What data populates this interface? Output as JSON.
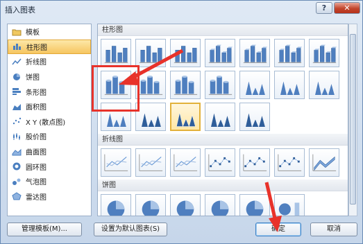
{
  "window": {
    "title": "插入图表",
    "help_label": "?",
    "close_label": "✕"
  },
  "sidebar": {
    "items": [
      {
        "label": "模板",
        "icon": "folder-icon"
      },
      {
        "label": "柱形图",
        "icon": "column-chart-icon",
        "selected": true
      },
      {
        "label": "折线图",
        "icon": "line-chart-icon"
      },
      {
        "label": "饼图",
        "icon": "pie-chart-icon"
      },
      {
        "label": "条形图",
        "icon": "bar-chart-icon"
      },
      {
        "label": "面积图",
        "icon": "area-chart-icon"
      },
      {
        "label": "X Y (散点图)",
        "icon": "scatter-chart-icon"
      },
      {
        "label": "股价图",
        "icon": "stock-chart-icon"
      },
      {
        "label": "曲面图",
        "icon": "surface-chart-icon"
      },
      {
        "label": "圆环图",
        "icon": "doughnut-chart-icon"
      },
      {
        "label": "气泡图",
        "icon": "bubble-chart-icon"
      },
      {
        "label": "雷达图",
        "icon": "radar-chart-icon"
      }
    ]
  },
  "sections": {
    "column": {
      "label": "柱形图",
      "thumbs": [
        "clustered-column",
        "stacked-column",
        "100-stacked-column",
        "3d-clustered-column",
        "3d-stacked-column",
        "3d-100-stacked-column",
        "3d-column",
        "clustered-cylinder",
        "stacked-cylinder",
        "100-stacked-cylinder",
        "3d-cylinder",
        "clustered-cone",
        "stacked-cone",
        "100-stacked-cone",
        "3d-cone",
        "clustered-pyramid",
        "stacked-pyramid",
        "100-stacked-pyramid",
        "3d-pyramid"
      ],
      "selected_index": 16
    },
    "line": {
      "label": "折线图",
      "thumbs": [
        "line",
        "stacked-line",
        "100-stacked-line",
        "line-markers",
        "stacked-line-markers",
        "100-stacked-line-markers",
        "3d-line"
      ]
    },
    "pie": {
      "label": "饼图",
      "thumbs": [
        "pie",
        "3d-pie",
        "pie-of-pie",
        "exploded-pie",
        "3d-exploded-pie",
        "bar-of-pie"
      ]
    }
  },
  "buttons": {
    "manage": "管理模板(M)...",
    "set_default": "设置为默认图表(S)",
    "ok": "确定",
    "cancel": "取消"
  },
  "annotation_color": "#e8322a"
}
